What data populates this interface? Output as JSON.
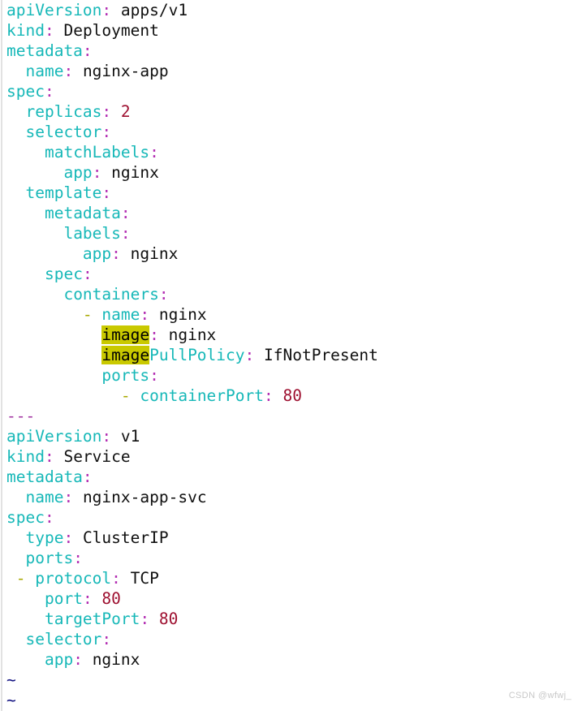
{
  "editor": {
    "name": "vim-text-editor",
    "background_color": "#ffffff",
    "colors": {
      "key": "#17b8b8",
      "colon": "#b32eb3",
      "value": "#101010",
      "number": "#9e1030",
      "list_dash": "#a8a800",
      "doc_separator": "#a032a0",
      "tilde": "#101080",
      "search_highlight_bg": "#c9c900",
      "search_highlight_fg": "#000000",
      "left_rule": "#e2e2e2"
    },
    "search_term": "image",
    "lines": [
      {
        "indent": 0,
        "tokens": [
          {
            "type": "key",
            "text": "apiVersion"
          },
          {
            "type": "colon",
            "text": ":"
          },
          {
            "type": "value",
            "text": " apps/v1"
          }
        ]
      },
      {
        "indent": 0,
        "tokens": [
          {
            "type": "key",
            "text": "kind"
          },
          {
            "type": "colon",
            "text": ":"
          },
          {
            "type": "value",
            "text": " Deployment"
          }
        ]
      },
      {
        "indent": 0,
        "tokens": [
          {
            "type": "key",
            "text": "metadata"
          },
          {
            "type": "colon",
            "text": ":"
          }
        ]
      },
      {
        "indent": 2,
        "tokens": [
          {
            "type": "key",
            "text": "name"
          },
          {
            "type": "colon",
            "text": ":"
          },
          {
            "type": "value",
            "text": " nginx-app"
          }
        ]
      },
      {
        "indent": 0,
        "tokens": [
          {
            "type": "key",
            "text": "spec"
          },
          {
            "type": "colon",
            "text": ":"
          }
        ]
      },
      {
        "indent": 2,
        "tokens": [
          {
            "type": "key",
            "text": "replicas"
          },
          {
            "type": "colon",
            "text": ":"
          },
          {
            "type": "number",
            "text": " 2"
          }
        ]
      },
      {
        "indent": 2,
        "tokens": [
          {
            "type": "key",
            "text": "selector"
          },
          {
            "type": "colon",
            "text": ":"
          }
        ]
      },
      {
        "indent": 4,
        "tokens": [
          {
            "type": "key",
            "text": "matchLabels"
          },
          {
            "type": "colon",
            "text": ":"
          }
        ]
      },
      {
        "indent": 6,
        "tokens": [
          {
            "type": "key",
            "text": "app"
          },
          {
            "type": "colon",
            "text": ":"
          },
          {
            "type": "value",
            "text": " nginx"
          }
        ]
      },
      {
        "indent": 2,
        "tokens": [
          {
            "type": "key",
            "text": "template"
          },
          {
            "type": "colon",
            "text": ":"
          }
        ]
      },
      {
        "indent": 4,
        "tokens": [
          {
            "type": "key",
            "text": "metadata"
          },
          {
            "type": "colon",
            "text": ":"
          }
        ]
      },
      {
        "indent": 6,
        "tokens": [
          {
            "type": "key",
            "text": "labels"
          },
          {
            "type": "colon",
            "text": ":"
          }
        ]
      },
      {
        "indent": 8,
        "tokens": [
          {
            "type": "key",
            "text": "app"
          },
          {
            "type": "colon",
            "text": ":"
          },
          {
            "type": "value",
            "text": " nginx"
          }
        ]
      },
      {
        "indent": 4,
        "tokens": [
          {
            "type": "key",
            "text": "spec"
          },
          {
            "type": "colon",
            "text": ":"
          }
        ]
      },
      {
        "indent": 6,
        "tokens": [
          {
            "type": "key",
            "text": "containers"
          },
          {
            "type": "colon",
            "text": ":"
          }
        ]
      },
      {
        "indent": 8,
        "tokens": [
          {
            "type": "dash",
            "text": "-"
          },
          {
            "type": "key",
            "text": " name"
          },
          {
            "type": "colon",
            "text": ":"
          },
          {
            "type": "value",
            "text": " nginx"
          }
        ]
      },
      {
        "indent": 10,
        "tokens": [
          {
            "type": "highlight",
            "text": "image"
          },
          {
            "type": "colon",
            "text": ":"
          },
          {
            "type": "value",
            "text": " nginx"
          }
        ]
      },
      {
        "indent": 10,
        "tokens": [
          {
            "type": "highlight",
            "text": "image"
          },
          {
            "type": "key",
            "text": "PullPolicy"
          },
          {
            "type": "colon",
            "text": ":"
          },
          {
            "type": "value",
            "text": " IfNotPresent"
          }
        ]
      },
      {
        "indent": 10,
        "tokens": [
          {
            "type": "key",
            "text": "ports"
          },
          {
            "type": "colon",
            "text": ":"
          }
        ]
      },
      {
        "indent": 12,
        "tokens": [
          {
            "type": "dash",
            "text": "-"
          },
          {
            "type": "key",
            "text": " containerPort"
          },
          {
            "type": "colon",
            "text": ":"
          },
          {
            "type": "number",
            "text": " 80"
          }
        ]
      },
      {
        "indent": 0,
        "tokens": [
          {
            "type": "docsep",
            "text": "---"
          }
        ]
      },
      {
        "indent": 0,
        "tokens": [
          {
            "type": "key",
            "text": "apiVersion"
          },
          {
            "type": "colon",
            "text": ":"
          },
          {
            "type": "value",
            "text": " v1"
          }
        ]
      },
      {
        "indent": 0,
        "tokens": [
          {
            "type": "key",
            "text": "kind"
          },
          {
            "type": "colon",
            "text": ":"
          },
          {
            "type": "value",
            "text": " Service"
          }
        ]
      },
      {
        "indent": 0,
        "tokens": [
          {
            "type": "key",
            "text": "metadata"
          },
          {
            "type": "colon",
            "text": ":"
          }
        ]
      },
      {
        "indent": 2,
        "tokens": [
          {
            "type": "key",
            "text": "name"
          },
          {
            "type": "colon",
            "text": ":"
          },
          {
            "type": "value",
            "text": " nginx-app-svc"
          }
        ]
      },
      {
        "indent": 0,
        "tokens": [
          {
            "type": "key",
            "text": "spec"
          },
          {
            "type": "colon",
            "text": ":"
          }
        ]
      },
      {
        "indent": 2,
        "tokens": [
          {
            "type": "key",
            "text": "type"
          },
          {
            "type": "colon",
            "text": ":"
          },
          {
            "type": "value",
            "text": " ClusterIP"
          }
        ]
      },
      {
        "indent": 2,
        "tokens": [
          {
            "type": "key",
            "text": "ports"
          },
          {
            "type": "colon",
            "text": ":"
          }
        ]
      },
      {
        "indent": 1,
        "tokens": [
          {
            "type": "dash",
            "text": "-"
          },
          {
            "type": "key",
            "text": " protocol"
          },
          {
            "type": "colon",
            "text": ":"
          },
          {
            "type": "value",
            "text": " TCP"
          }
        ]
      },
      {
        "indent": 4,
        "tokens": [
          {
            "type": "key",
            "text": "port"
          },
          {
            "type": "colon",
            "text": ":"
          },
          {
            "type": "number",
            "text": " 80"
          }
        ]
      },
      {
        "indent": 4,
        "tokens": [
          {
            "type": "key",
            "text": "targetPort"
          },
          {
            "type": "colon",
            "text": ":"
          },
          {
            "type": "number",
            "text": " 80"
          }
        ]
      },
      {
        "indent": 2,
        "tokens": [
          {
            "type": "key",
            "text": "selector"
          },
          {
            "type": "colon",
            "text": ":"
          }
        ]
      },
      {
        "indent": 4,
        "tokens": [
          {
            "type": "key",
            "text": "app"
          },
          {
            "type": "colon",
            "text": ":"
          },
          {
            "type": "value",
            "text": " nginx"
          }
        ]
      },
      {
        "indent": 0,
        "tokens": [
          {
            "type": "tilde",
            "text": "~"
          }
        ]
      },
      {
        "indent": 0,
        "tokens": [
          {
            "type": "tilde",
            "text": "~"
          }
        ]
      }
    ]
  },
  "watermark": {
    "text": "CSDN @wfwj_"
  }
}
